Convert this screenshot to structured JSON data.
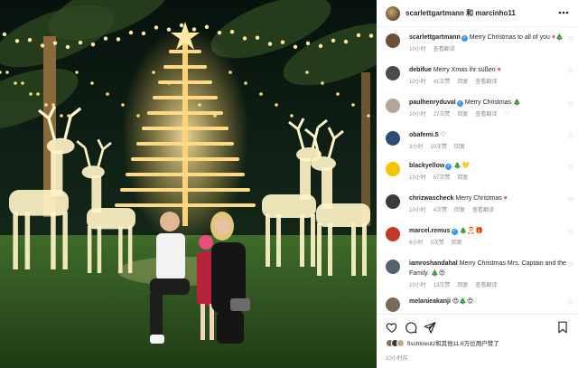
{
  "header": {
    "title": "scarlettgartmann 和 marcinho11"
  },
  "comments": [
    {
      "user": "scarlettgartmann",
      "verified": true,
      "text": "Merry Christmas to all of you",
      "emoji": "♥🎄",
      "time": "10小时",
      "actions": [
        "查看翻译"
      ],
      "avatar_color": "#6b4f3a"
    },
    {
      "user": "debifue",
      "verified": false,
      "text": "Merry Xmas ihr süßen",
      "emoji": "♥",
      "time": "10小时",
      "likes": "41次赞",
      "actions": [
        "回复",
        "查看翻译"
      ],
      "avatar_color": "#4a4a4a"
    },
    {
      "user": "paulhenryduval",
      "verified": true,
      "text": "Merry Christmas",
      "emoji": "🎄",
      "time": "10小时",
      "likes": "27次赞",
      "actions": [
        "回复",
        "查看翻译",
        "···"
      ],
      "avatar_color": "#b9a595"
    },
    {
      "user": "obafemi.5",
      "verified": false,
      "text": "",
      "emoji": "♡",
      "time": "3小时",
      "likes": "10次赞",
      "actions": [
        "回复"
      ],
      "avatar_color": "#2f4b7a"
    },
    {
      "user": "blackyellow",
      "verified": true,
      "text": "",
      "emoji": "🎄💛",
      "time": "10小时",
      "likes": "67次赞",
      "actions": [
        "回复"
      ],
      "avatar_color": "#f5c400"
    },
    {
      "user": "chrizwascheck",
      "verified": false,
      "text": "Merry Christmas",
      "emoji": "♥",
      "time": "10小时",
      "likes": "4次赞",
      "actions": [
        "回复",
        "查看翻译"
      ],
      "avatar_color": "#3b3b3b"
    },
    {
      "user": "marcel.remus",
      "verified": true,
      "text": "",
      "emoji": "🎄🎅🎁",
      "time": "6小时",
      "likes": "3次赞",
      "actions": [
        "回复"
      ],
      "avatar_color": "#c0392b"
    },
    {
      "user": "iamroshandahal",
      "verified": false,
      "text": "Merry Christmas Mrs. Captain and the Family.",
      "emoji": "🎄😍",
      "time": "10小时",
      "likes": "13次赞",
      "actions": [
        "回复",
        "查看翻译"
      ],
      "avatar_color": "#55616e"
    },
    {
      "user": "melanieakanji",
      "verified": false,
      "text": "",
      "emoji": "😍🎄😍",
      "time": "",
      "likes": "",
      "actions": [],
      "avatar_color": "#7a6a5a"
    }
  ],
  "likes": {
    "text": "fischkreutz和其他11.6万位用户赞了"
  },
  "post_time": "10小时前",
  "colors": {
    "verified": "#3897f0",
    "heart": "#ed4956",
    "meta": "#8e8e8e"
  }
}
